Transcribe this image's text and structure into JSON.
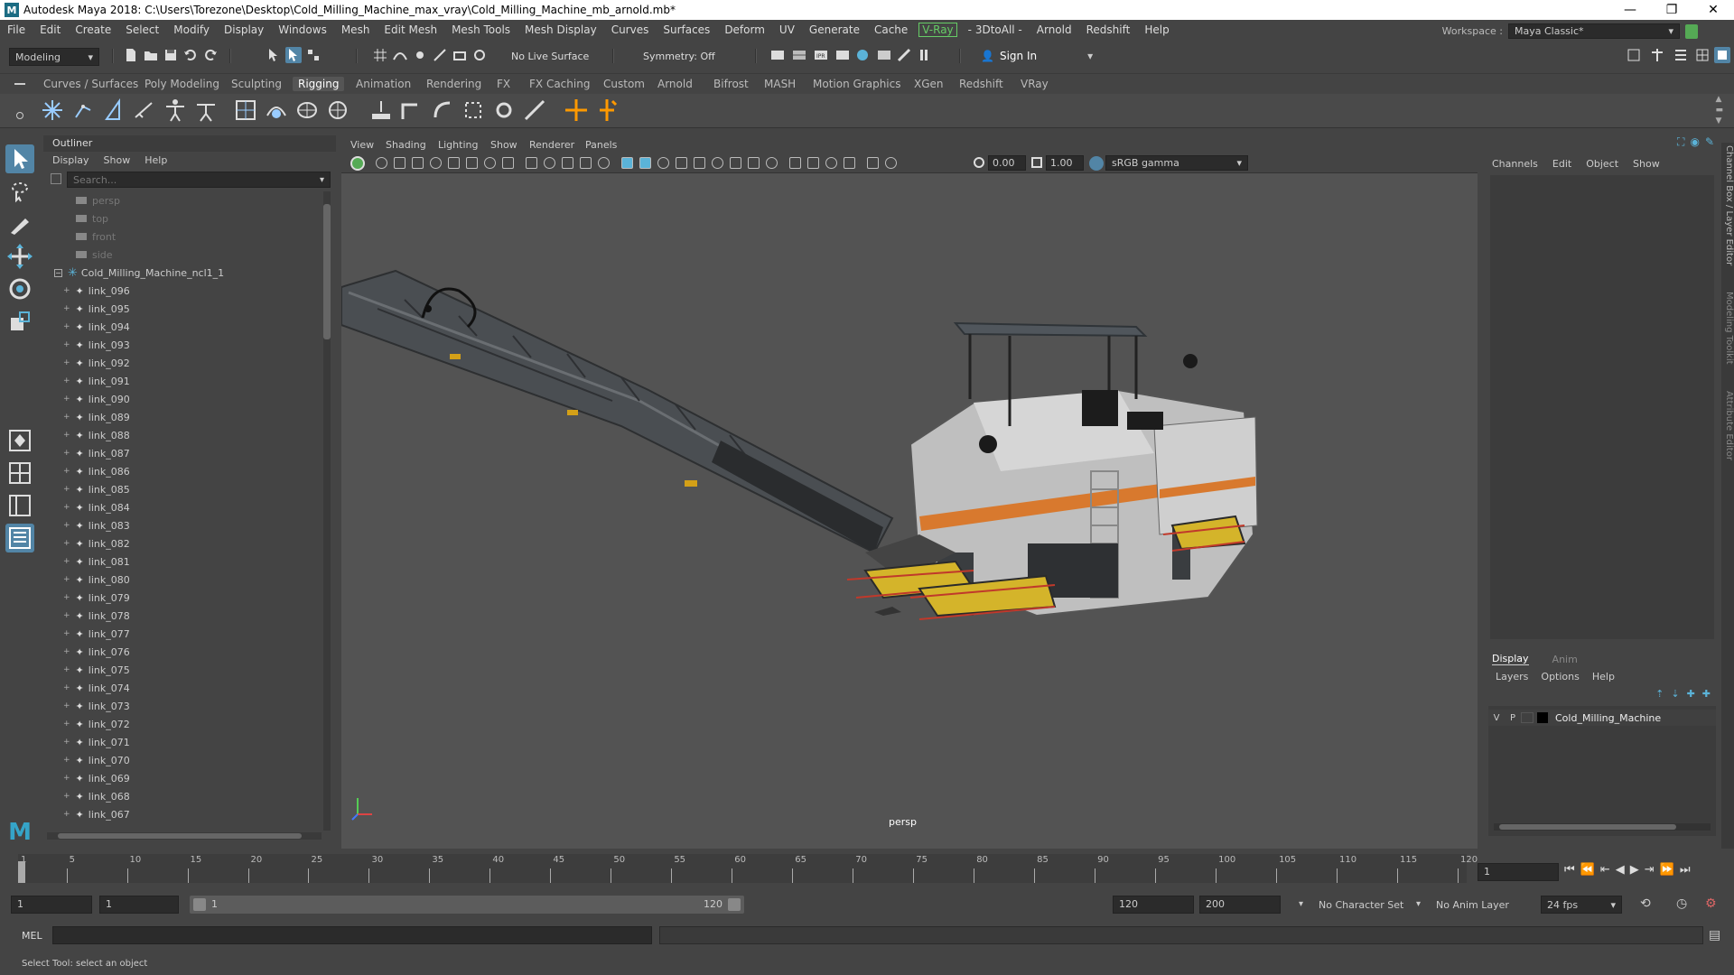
{
  "window": {
    "title": "Autodesk Maya 2018: C:\\Users\\Torezone\\Desktop\\Cold_Milling_Machine_max_vray\\Cold_Milling_Machine_mb_arnold.mb*",
    "min": "—",
    "max": "❐",
    "close": "✕"
  },
  "menubar": {
    "items": [
      "File",
      "Edit",
      "Create",
      "Select",
      "Modify",
      "Display",
      "Windows",
      "Mesh",
      "Edit Mesh",
      "Mesh Tools",
      "Mesh Display",
      "Curves",
      "Surfaces",
      "Deform",
      "UV",
      "Generate",
      "Cache"
    ],
    "vray": "V-Ray",
    "items2": [
      "- 3DtoAll -",
      "Arnold",
      "Redshift",
      "Help"
    ],
    "workspace_label": "Workspace :",
    "workspace_value": "Maya Classic*"
  },
  "statusline": {
    "mode": "Modeling",
    "live_surface": "No Live Surface",
    "symmetry": "Symmetry: Off",
    "sign_in": "Sign In"
  },
  "shelf": {
    "tabs": [
      "Curves / Surfaces",
      "Poly Modeling",
      "Sculpting",
      "Rigging",
      "Animation",
      "Rendering",
      "FX",
      "FX Caching",
      "Custom",
      "Arnold",
      "Bifrost",
      "MASH",
      "Motion Graphics",
      "XGen",
      "Redshift",
      "VRay"
    ],
    "active": "Rigging"
  },
  "outliner": {
    "title": "Outliner",
    "menus": [
      "Display",
      "Show",
      "Help"
    ],
    "search_placeholder": "Search...",
    "cameras": [
      "persp",
      "top",
      "front",
      "side"
    ],
    "root": "Cold_Milling_Machine_ncl1_1",
    "links": [
      "link_096",
      "link_095",
      "link_094",
      "link_093",
      "link_092",
      "link_091",
      "link_090",
      "link_089",
      "link_088",
      "link_087",
      "link_086",
      "link_085",
      "link_084",
      "link_083",
      "link_082",
      "link_081",
      "link_080",
      "link_079",
      "link_078",
      "link_077",
      "link_076",
      "link_075",
      "link_074",
      "link_073",
      "link_072",
      "link_071",
      "link_070",
      "link_069",
      "link_068",
      "link_067"
    ]
  },
  "viewport": {
    "menus": [
      "View",
      "Shading",
      "Lighting",
      "Show",
      "Renderer",
      "Panels"
    ],
    "exposure": "0.00",
    "gamma": "1.00",
    "colorspace": "sRGB gamma",
    "camera_label": "persp"
  },
  "channelbox": {
    "menus": [
      "Channels",
      "Edit",
      "Object",
      "Show"
    ],
    "tabs": [
      "Display",
      "Anim"
    ],
    "layer_menus": [
      "Layers",
      "Options",
      "Help"
    ],
    "layer": {
      "v": "V",
      "p": "P",
      "name": "Cold_Milling_Machine"
    }
  },
  "side_tabs": [
    "Channel Box / Layer Editor",
    "Modeling Toolkit",
    "Attribute Editor"
  ],
  "timeline": {
    "ticks": [
      1,
      5,
      10,
      15,
      20,
      25,
      30,
      35,
      40,
      45,
      50,
      55,
      60,
      65,
      70,
      75,
      80,
      85,
      90,
      95,
      100,
      105,
      110,
      115,
      120
    ],
    "current_frame": "1"
  },
  "range": {
    "start": "1",
    "playback_start": "1",
    "slider_start": "1",
    "slider_end": "120",
    "playback_end": "120",
    "end": "200",
    "character_set": "No Character Set",
    "anim_layer": "No Anim Layer",
    "fps": "24 fps"
  },
  "cmdline": {
    "label": "MEL"
  },
  "helpline": {
    "text": "Select Tool: select an object"
  },
  "colors": {
    "accent": "#5285a6",
    "bg": "#444444",
    "viewport": "#535353"
  }
}
